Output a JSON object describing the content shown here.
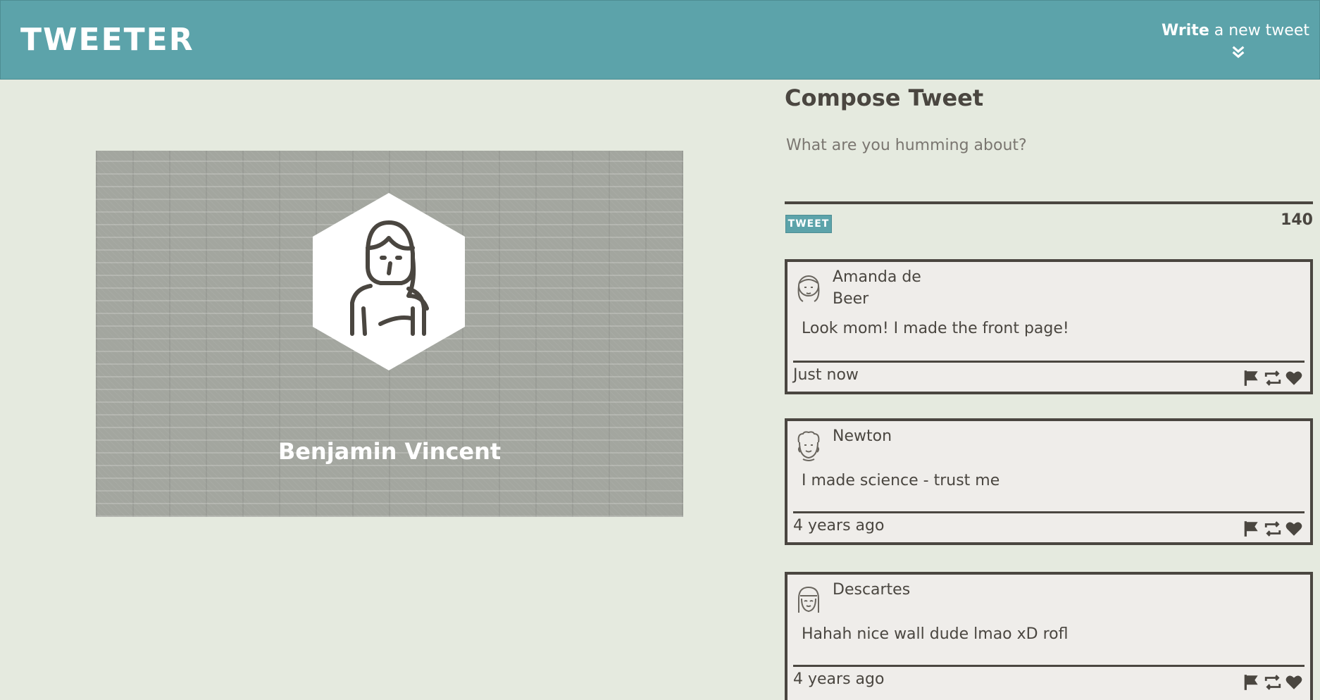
{
  "header": {
    "logo": "TWEETER",
    "write_bold": "Write",
    "write_rest": " a new tweet",
    "toggle_icon": "double-chevron-down-icon"
  },
  "profile": {
    "name": "Benjamin Vincent",
    "avatar_icon": "person-avatar-icon"
  },
  "compose": {
    "title": "Compose Tweet",
    "placeholder": "What are you humming about?",
    "button_label": "TWEET",
    "counter": "140"
  },
  "tweets": [
    {
      "name": "Amanda de Beer",
      "body": "Look mom! I made the front page!",
      "time": "Just now"
    },
    {
      "name": "Newton",
      "body": "I made science - trust me",
      "time": "4 years ago"
    },
    {
      "name": "Descartes",
      "body": "Hahah nice wall dude lmao xD rofl",
      "time": "4 years ago"
    }
  ],
  "colors": {
    "header_bg": "#5ca3aa",
    "page_bg": "#e5eadf",
    "text": "#4a4640"
  }
}
